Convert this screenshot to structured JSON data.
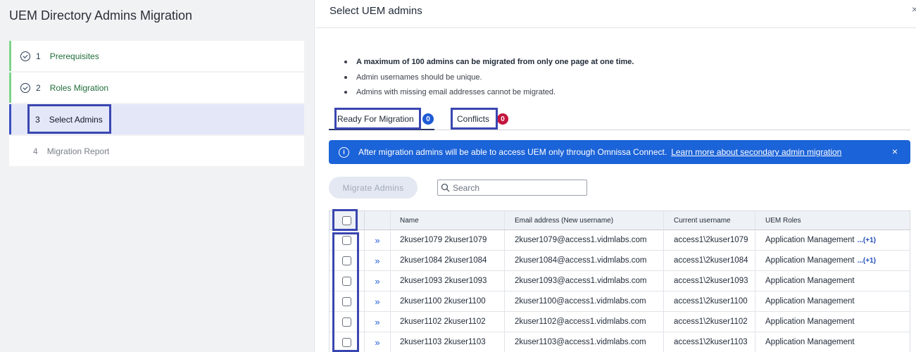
{
  "wizard": {
    "title": "UEM Directory Admins Migration",
    "steps": [
      {
        "num": "1",
        "label": "Prerequisites",
        "state": "done"
      },
      {
        "num": "2",
        "label": "Roles Migration",
        "state": "done"
      },
      {
        "num": "3",
        "label": "Select Admins",
        "state": "active"
      },
      {
        "num": "4",
        "label": "Migration Report",
        "state": "todo"
      }
    ]
  },
  "header": {
    "title": "Select UEM admins",
    "close": "×"
  },
  "notes": [
    "A maximum of 100 admins can be migrated from only one page at one time.",
    "Admin usernames should be unique.",
    "Admins with missing email addresses cannot be migrated."
  ],
  "tabs": [
    {
      "label": "Ready For Migration",
      "count": "0"
    },
    {
      "label": "Conflicts",
      "count": "0"
    }
  ],
  "banner": {
    "text": "After migration admins will be able to access UEM only through Omnissa Connect.",
    "link": "Learn more about secondary admin migration",
    "info": "i",
    "close": "×"
  },
  "toolbar": {
    "migrate_label": "Migrate Admins",
    "search_placeholder": "Search"
  },
  "table": {
    "expand_glyph": "»",
    "columns": [
      "Name",
      "Email address (New username)",
      "Current username",
      "UEM Roles"
    ],
    "rows": [
      {
        "name": "2kuser1079 2kuser1079",
        "email": "2kuser1079@access1.vidmlabs.com",
        "user": "access1\\2kuser1079",
        "roles": "Application Management",
        "more": "...(+1)"
      },
      {
        "name": "2kuser1084 2kuser1084",
        "email": "2kuser1084@access1.vidmlabs.com",
        "user": "access1\\2kuser1084",
        "roles": "Application Management",
        "more": "...(+1)"
      },
      {
        "name": "2kuser1093 2kuser1093",
        "email": "2kuser1093@access1.vidmlabs.com",
        "user": "access1\\2kuser1093",
        "roles": "Application Management",
        "more": ""
      },
      {
        "name": "2kuser1100 2kuser1100",
        "email": "2kuser1100@access1.vidmlabs.com",
        "user": "access1\\2kuser1100",
        "roles": "Application Management",
        "more": ""
      },
      {
        "name": "2kuser1102 2kuser1102",
        "email": "2kuser1102@access1.vidmlabs.com",
        "user": "access1\\2kuser1102",
        "roles": "Application Management",
        "more": ""
      },
      {
        "name": "2kuser1103 2kuser1103",
        "email": "2kuser1103@access1.vidmlabs.com",
        "user": "access1\\2kuser1103",
        "roles": "Application Management",
        "more": ""
      }
    ]
  },
  "colors": {
    "accent": "#1b63d8",
    "highlight": "#3a46b0",
    "done": "#216e3a",
    "conflict": "#c4153e"
  }
}
